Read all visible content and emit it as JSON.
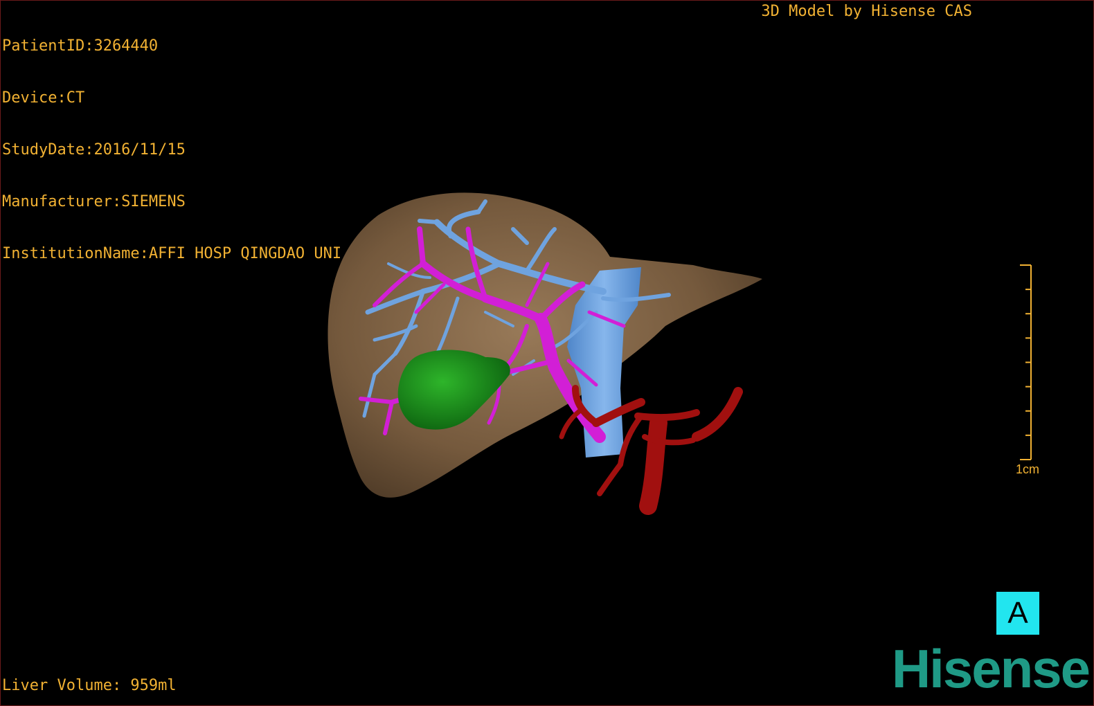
{
  "info": {
    "patient_id": "PatientID:3264440",
    "device": "Device:CT",
    "study_date": "StudyDate:2016/11/15",
    "manufacturer": "Manufacturer:SIEMENS",
    "institution": "InstitutionName:AFFI HOSP QINGDAO UNI"
  },
  "header": {
    "model_by": "3D Model by Hisense CAS"
  },
  "footer": {
    "liver_volume": "Liver Volume: 959ml"
  },
  "scale_bar": {
    "label": "1cm",
    "tick_count": 9
  },
  "orientation": {
    "label": "A"
  },
  "logo": {
    "text": "Hisense"
  },
  "colors": {
    "overlay_text": "#f2b233",
    "liver": "#8a6a45",
    "hepatic_vein": "#6fa3df",
    "portal_vein": "#d21fd6",
    "gallbladder": "#128a16",
    "artery": "#a1100f",
    "orientation_bg": "#22e5ef",
    "logo": "#1f9a86"
  }
}
